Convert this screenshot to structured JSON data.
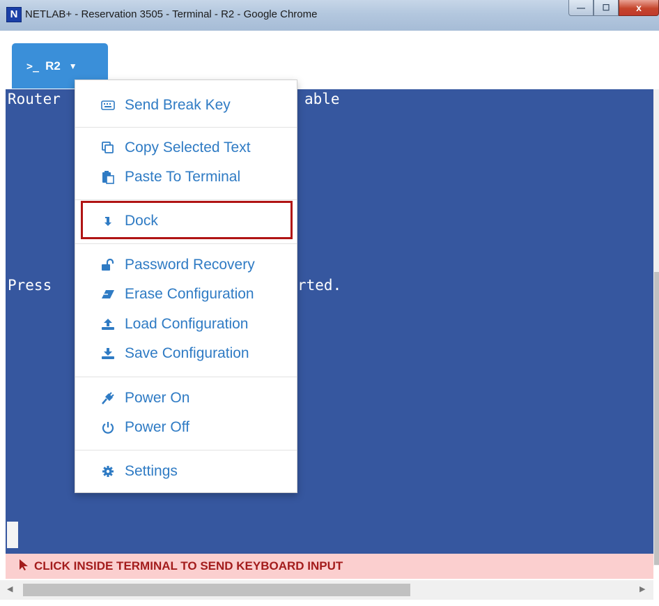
{
  "window": {
    "title": "NETLAB+ - Reservation 3505 - Terminal - R2 - Google Chrome",
    "app_icon_letter": "N",
    "controls": {
      "minimize": "—",
      "maximize": "☐",
      "close": "x"
    }
  },
  "toolbar": {
    "device_prompt": ">_",
    "device_label": "R2",
    "device_caret": "▼"
  },
  "terminal": {
    "lines": [
      {
        "text": "Router",
        "after": "able"
      },
      {
        "text": "Press",
        "after": "rted."
      }
    ],
    "bg_color": "#36579f"
  },
  "menu": {
    "items": [
      {
        "label": "Send Break Key",
        "icon": "keyboard-icon"
      },
      {
        "label": "Copy Selected Text",
        "icon": "copy-icon"
      },
      {
        "label": "Paste To Terminal",
        "icon": "paste-icon"
      },
      {
        "label": "Dock",
        "icon": "dock-arrow-icon"
      },
      {
        "label": "Password Recovery",
        "icon": "unlock-icon"
      },
      {
        "label": "Erase Configuration",
        "icon": "eraser-icon"
      },
      {
        "label": "Load Configuration",
        "icon": "upload-icon"
      },
      {
        "label": "Save Configuration",
        "icon": "download-icon"
      },
      {
        "label": "Power On",
        "icon": "plug-icon"
      },
      {
        "label": "Power Off",
        "icon": "power-icon"
      },
      {
        "label": "Settings",
        "icon": "gear-icon"
      }
    ],
    "highlighted": "Dock",
    "accent_color": "#2f7bc4"
  },
  "hint": {
    "text": "CLICK INSIDE TERMINAL TO SEND KEYBOARD INPUT",
    "color": "#a31c1c"
  }
}
